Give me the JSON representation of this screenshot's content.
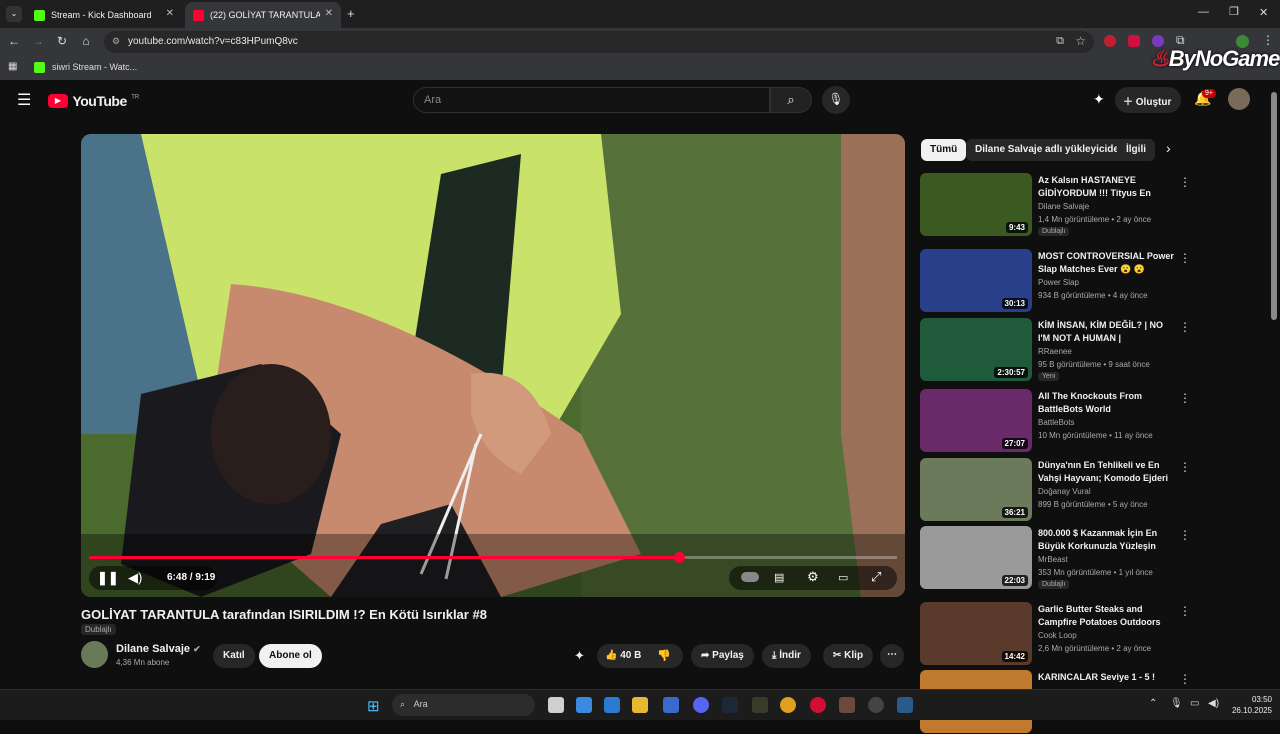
{
  "browser": {
    "tabs": [
      {
        "title": "Stream - Kick Dashboard"
      },
      {
        "title": "(22) GOLİYAT TARANTULA t"
      }
    ],
    "url": "youtube.com/watch?v=c83HPumQ8vc",
    "bookmark": "siwri Stream - Watc...",
    "watermark": "ByNoGame"
  },
  "youtube": {
    "logo": "YouTube",
    "region": "TR",
    "search_placeholder": "Ara",
    "create_label": "Oluştur",
    "notification_count": "9+"
  },
  "player": {
    "time": "6:48 / 9:19",
    "progress": 0.73
  },
  "video": {
    "title": "GOLİYAT TARANTULA tarafından ISIRILDIM !? En Kötü Isırıklar #8",
    "dub_badge": "Dublajlı",
    "channel": "Dilane Salvaje",
    "subscribers": "4,36 Mn abone",
    "join_label": "Katıl",
    "subscribe_label": "Abone ol",
    "likes": "40 B",
    "share_label": "Paylaş",
    "download_label": "İndir",
    "clip_label": "Klip"
  },
  "chips": [
    "Tümü",
    "Dilane Salvaje adlı yükleyiciden",
    "İlgili"
  ],
  "recommendations": [
    {
      "title": "Az Kalsın HASTANEYE GİDİYORDUM !!! Tityus En Kötü...",
      "channel": "Dilane Salvaje",
      "meta": "1,4 Mn görüntüleme • 2 ay önce",
      "duration": "9:43",
      "badge": "Dublajlı",
      "color": "#3a5a22"
    },
    {
      "title": "MOST CONTROVERSIAL Power Slap Matches Ever 😮 😮",
      "channel": "Power Slap",
      "meta": "934 B görüntüleme • 4 ay önce",
      "duration": "30:13",
      "badge": "",
      "color": "#2a3f8a"
    },
    {
      "title": "KİM İNSAN, KİM DEĞİL? | NO I'M NOT A HUMAN |",
      "channel": "RRaenee",
      "meta": "95 B görüntüleme • 9 saat önce",
      "duration": "2:30:57",
      "badge": "Yeni",
      "color": "#1f5a3a"
    },
    {
      "title": "All The Knockouts From BattleBots World Championshi...",
      "channel": "BattleBots",
      "meta": "10 Mn görüntüleme • 11 ay önce",
      "duration": "27:07",
      "badge": "",
      "color": "#6a2a6a"
    },
    {
      "title": "Dünya'nın En Tehlikeli ve En Vahşi Hayvanı; Komodo Ejderi ...",
      "channel": "Doğanay Vural",
      "meta": "899 B görüntüleme • 5 ay önce",
      "duration": "36:21",
      "badge": "",
      "color": "#6a7a5a"
    },
    {
      "title": "800.000 $ Kazanmak İçin En Büyük Korkunuzla Yüzleşin",
      "channel": "MrBeast",
      "meta": "353 Mn görüntüleme • 1 yıl önce",
      "duration": "22:03",
      "badge": "Dublajlı",
      "color": "#9a9a9a"
    },
    {
      "title": "Garlic Butter Steaks and Campfire Potatoes Outdoors",
      "channel": "Cook Loop",
      "meta": "2,6 Mn görüntüleme • 2 ay önce",
      "duration": "14:42",
      "badge": "",
      "color": "#5a3a2a"
    },
    {
      "title": "KARINCALAR Seviye 1 - 5 !",
      "channel": "",
      "meta": "",
      "duration": "",
      "badge": "",
      "color": "#c07a30"
    }
  ],
  "taskbar": {
    "search_placeholder": "Ara",
    "time": "03:50",
    "date": "26.10.2025"
  },
  "colors": {
    "accent": "#ff0033",
    "kick": "#53fc18"
  }
}
